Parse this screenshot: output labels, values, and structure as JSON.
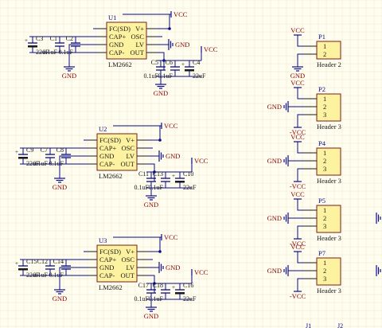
{
  "colors": {
    "background": "#fffdf0",
    "grid": "#ebe6c8",
    "wire": "#0a0a8a",
    "pin": "#1a1a1a",
    "component_fill": "#fdf2a0",
    "component_stroke": "#7a1a1a",
    "designator": "#0a0a8a",
    "text": "#1a1a1a",
    "power_label": "#8a0000",
    "cap_fill": "#1a1a1a"
  },
  "power_nets": {
    "vcc": "VCC",
    "gnd": "GND",
    "neg_vcc": "-VCC"
  },
  "regulators": [
    {
      "designator": "U1",
      "part": "LM2662",
      "pins_left": [
        "FC(SD)",
        "CAP+",
        "GND",
        "CAP-"
      ],
      "pins_right": [
        "V+",
        "OSC",
        "LV",
        "OUT"
      ],
      "caps": [
        {
          "designator": "C3",
          "value": "22uF",
          "polar": true
        },
        {
          "designator": "C1",
          "value": "0.1uF",
          "polar": false
        },
        {
          "designator": "C2",
          "value": "0.1uF",
          "polar": false
        },
        {
          "designator": "C5",
          "value": "0.1uF",
          "polar": false
        },
        {
          "designator": "C6",
          "value": "0.1uF",
          "polar": false
        },
        {
          "designator": "C4",
          "value": "22uF",
          "polar": true
        }
      ]
    },
    {
      "designator": "U2",
      "part": "LM2662",
      "pins_left": [
        "FC(SD)",
        "CAP+",
        "GND",
        "CAP-"
      ],
      "pins_right": [
        "V+",
        "OSC",
        "LV",
        "OUT"
      ],
      "caps": [
        {
          "designator": "C9",
          "value": "22uF",
          "polar": true
        },
        {
          "designator": "C7",
          "value": "0.1uF",
          "polar": false
        },
        {
          "designator": "C8",
          "value": "0.1uF",
          "polar": false
        },
        {
          "designator": "C11",
          "value": "0.1uF",
          "polar": false
        },
        {
          "designator": "C13",
          "value": "0.1uF",
          "polar": false
        },
        {
          "designator": "C10",
          "value": "22uF",
          "polar": true
        }
      ]
    },
    {
      "designator": "U3",
      "part": "LM2662",
      "pins_left": [
        "FC(SD)",
        "CAP+",
        "GND",
        "CAP-"
      ],
      "pins_right": [
        "V+",
        "OSC",
        "LV",
        "OUT"
      ],
      "caps": [
        {
          "designator": "C15",
          "value": "22uF",
          "polar": true
        },
        {
          "designator": "C12",
          "value": "0.1uF",
          "polar": false
        },
        {
          "designator": "C14",
          "value": "0.1uF",
          "polar": false
        },
        {
          "designator": "C17",
          "value": "0.1uF",
          "polar": false
        },
        {
          "designator": "C18",
          "value": "0.1uF",
          "polar": false
        },
        {
          "designator": "C16",
          "value": "22uF",
          "polar": true
        }
      ]
    }
  ],
  "headers": [
    {
      "designator": "P1",
      "part": "Header 2",
      "pins": [
        "1",
        "2"
      ]
    },
    {
      "designator": "P2",
      "part": "Header 3",
      "pins": [
        "1",
        "2",
        "3"
      ]
    },
    {
      "designator": "P4",
      "part": "Header 3",
      "pins": [
        "1",
        "2",
        "3"
      ]
    },
    {
      "designator": "P5",
      "part": "Header 3",
      "pins": [
        "1",
        "2",
        "3"
      ]
    },
    {
      "designator": "P7",
      "part": "Header 3",
      "pins": [
        "1",
        "2",
        "3"
      ]
    }
  ],
  "bottom_labels": [
    "J1",
    "J2"
  ]
}
